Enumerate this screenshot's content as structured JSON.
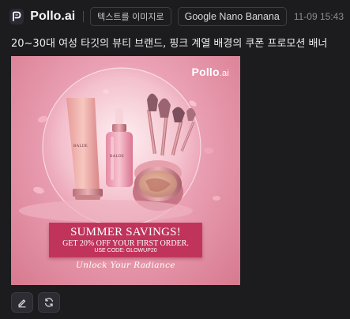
{
  "header": {
    "app_name": "Pollo.ai",
    "mode_chip": "텍스트를 이미지로",
    "model_chip": "Google Nano Banana",
    "timestamp": "11-09 15:43"
  },
  "prompt_text": "20~30대 여성 타깃의 뷰티 브랜드, 핑크 계열 배경의 쿠폰 프로모션 배너",
  "generated_image": {
    "watermark": "Pollo",
    "watermark_suffix": ".ai",
    "tube_label": "BALDE",
    "bottle_label": "BALDE",
    "banner_title": "SUMMER SAVINGS!",
    "banner_offer": "GET 20% OFF YOUR FIRST ORDER.",
    "banner_code": "USE CODE: GLOWUP20",
    "tagline": "Unlock Your Radiance"
  },
  "actions": [
    {
      "icon": "edit-icon"
    },
    {
      "icon": "regenerate-icon"
    }
  ],
  "colors": {
    "background": "#1c1c1f",
    "banner": "#c0345c",
    "image_pink": "#eaa0b3"
  }
}
